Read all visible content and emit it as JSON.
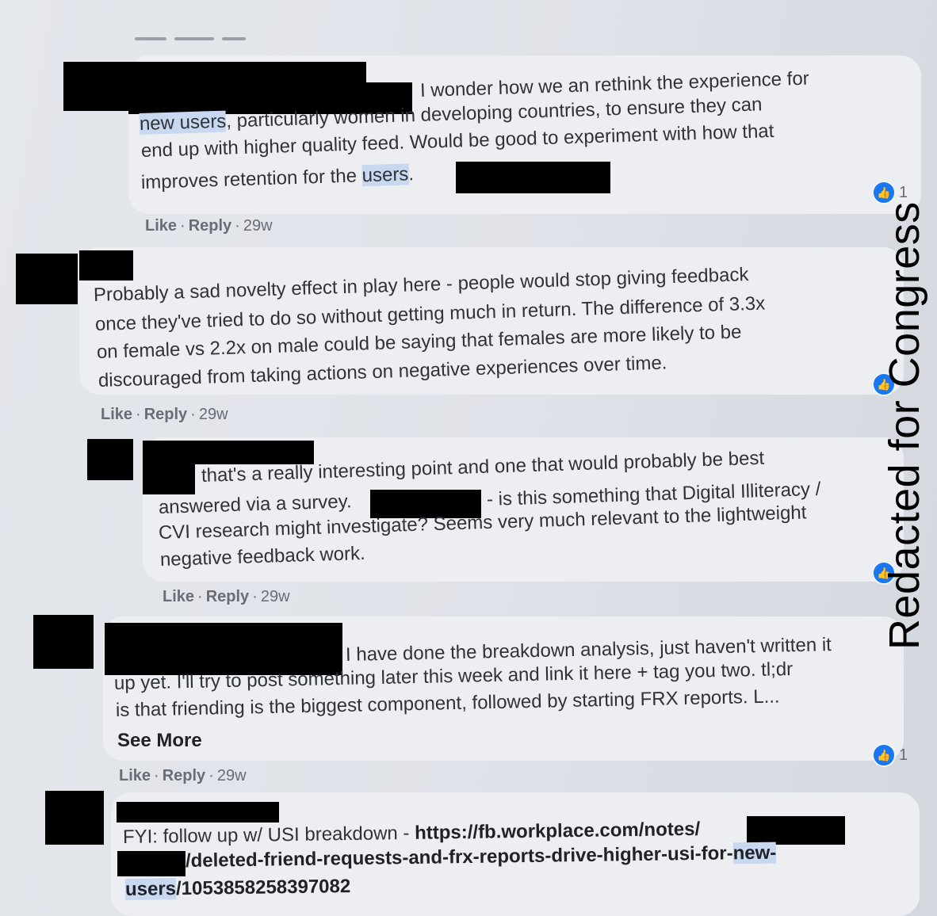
{
  "comments": [
    {
      "text_parts": [
        "I wonder how we an rethink the experience for",
        "new users",
        ", particularly women in developing countries, to ensure they can",
        "end up with higher quality feed. Would be good to experiment with how that",
        "improves retention for the ",
        "users",
        "."
      ],
      "actions": {
        "like": "Like",
        "reply": "Reply",
        "time": "29w"
      },
      "reaction_count": "1"
    },
    {
      "lines": [
        "Probably a sad novelty effect in play here - people would stop giving feedback",
        "once they've tried to do so without getting much in return. The difference of 3.3x",
        "on female vs 2.2x on male could be saying that females are more likely to be",
        "discouraged from taking actions on negative experiences over time."
      ],
      "actions": {
        "like": "Like",
        "reply": "Reply",
        "time": "29w"
      }
    },
    {
      "lines": [
        "that's a really interesting point and one that would probably be best",
        "answered via a survey.",
        "- is this something that Digital Illiteracy /",
        "CVI research might investigate? Seems very much relevant to the lightweight",
        "negative feedback work."
      ],
      "actions": {
        "like": "Like",
        "reply": "Reply",
        "time": "29w"
      }
    },
    {
      "lines": [
        "I have done the breakdown analysis, just haven't written it",
        "up yet. I'll try to post something later this week and link it here + tag you two. tl;dr",
        "is that friending is the biggest component, followed by starting FRX reports. L..."
      ],
      "see_more": "See More",
      "actions": {
        "like": "Like",
        "reply": "Reply",
        "time": "29w"
      },
      "reaction_count": "1"
    },
    {
      "prefix": "FYI: follow up w/ USI breakdown - ",
      "link_1": "https://fb.workplace.com/notes/",
      "link_2": "/deleted-friend-requests-and-frx-reports-drive-higher-usi-for-",
      "link_2_hl": "new-",
      "link_3_hl": "users",
      "link_3": "/1053858258397082"
    }
  ],
  "watermark": "Redacted for Congress",
  "icons": {
    "like": "thumbs-up-icon"
  },
  "colors": {
    "like_blue": "#1877f2",
    "highlight": "#c7d8f0"
  }
}
